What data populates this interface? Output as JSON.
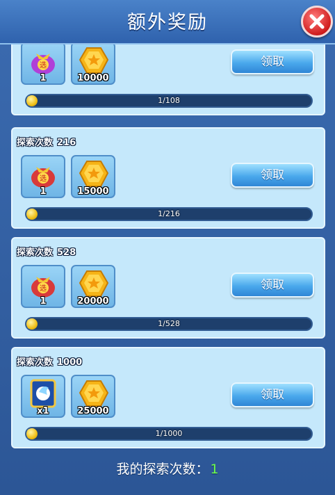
{
  "title": "额外奖励",
  "close_icon": "close-x-icon",
  "colors": {
    "accent": "#4aa8ec",
    "count_green": "#6fff4a",
    "card_bg": "#c5e8fb"
  },
  "cards": [
    {
      "label": "",
      "count": "",
      "items": [
        {
          "icon": "lucky-bag-icon",
          "qty": "1"
        },
        {
          "icon": "gold-coin-icon",
          "qty": "10000"
        }
      ],
      "claim_label": "领取",
      "progress_text": "1/108",
      "progress_fraction": 0.009
    },
    {
      "label": "探索次数",
      "count": "216",
      "items": [
        {
          "icon": "lucky-bag-icon",
          "qty": "1"
        },
        {
          "icon": "gold-coin-icon",
          "qty": "15000"
        }
      ],
      "claim_label": "领取",
      "progress_text": "1/216",
      "progress_fraction": 0.005
    },
    {
      "label": "探索次数",
      "count": "528",
      "items": [
        {
          "icon": "lucky-bag-icon",
          "qty": "1"
        },
        {
          "icon": "gold-coin-icon",
          "qty": "20000"
        }
      ],
      "claim_label": "领取",
      "progress_text": "1/528",
      "progress_fraction": 0.002
    },
    {
      "label": "探索次数",
      "count": "1000",
      "items": [
        {
          "icon": "spirit-card-icon",
          "qty": "x1"
        },
        {
          "icon": "gold-coin-icon",
          "qty": "25000"
        }
      ],
      "claim_label": "领取",
      "progress_text": "1/1000",
      "progress_fraction": 0.001
    }
  ],
  "footer": {
    "label": "我的探索次数：",
    "count": "1"
  }
}
